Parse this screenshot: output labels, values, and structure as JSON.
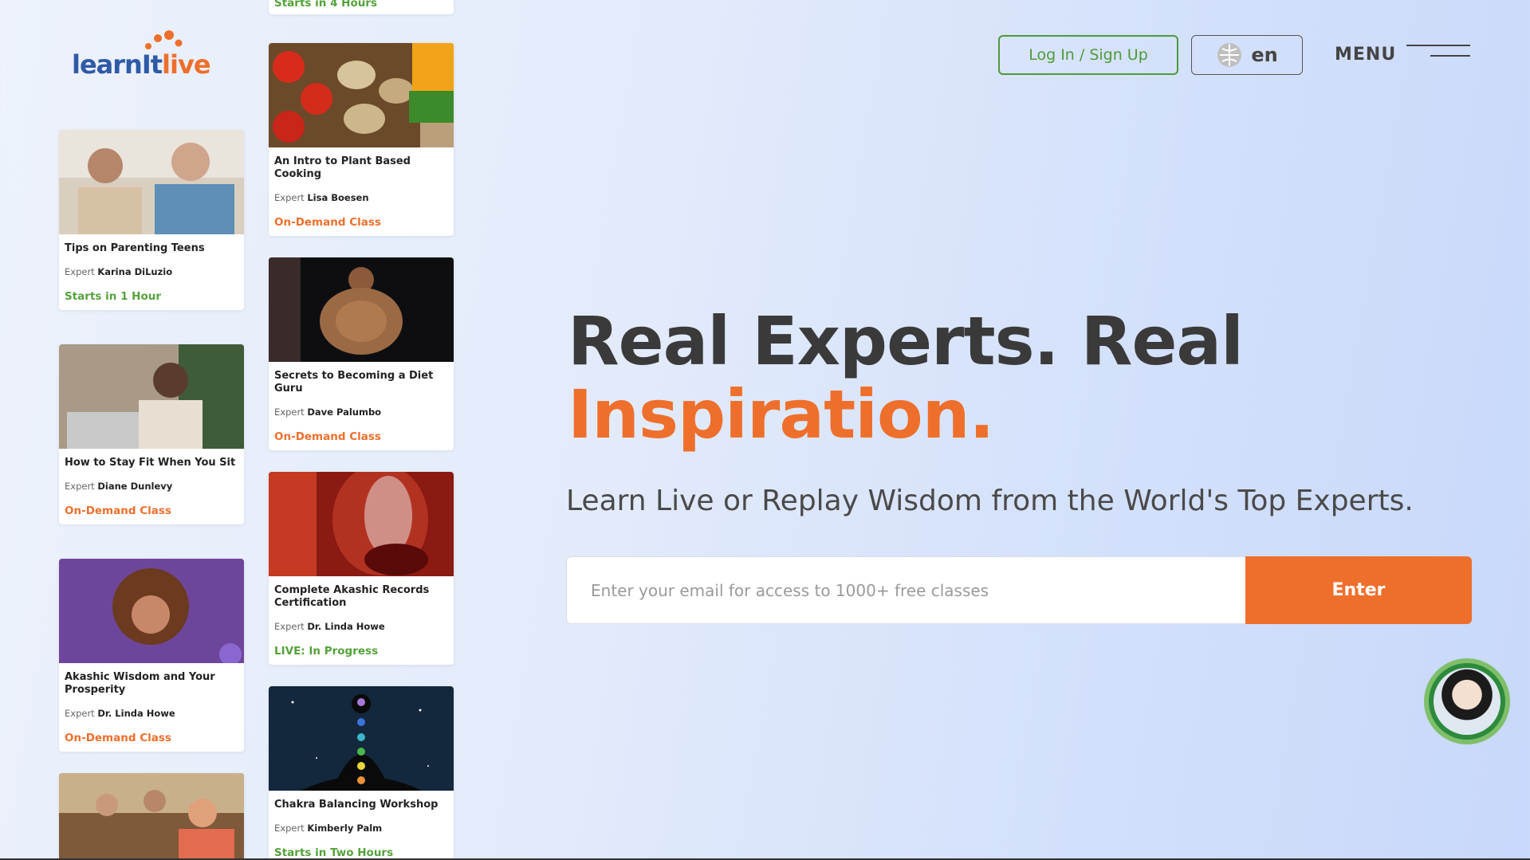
{
  "brand": {
    "logo_main": "learnIt",
    "logo_accent": "live",
    "colors": {
      "blue": "#2e5aa6",
      "orange": "#ee6f2c",
      "green": "#54a23a"
    }
  },
  "header": {
    "login_label": "Log In / Sign Up",
    "lang_label": "en",
    "lang_icon": "globe-icon",
    "menu_label": "MENU",
    "menu_icon": "hamburger-icon"
  },
  "hero": {
    "headline_part1": "Real Experts. Real",
    "headline_accent": "Inspiration.",
    "subhead": "Learn Live or Replay Wisdom from the World's Top Experts.",
    "email_placeholder": "Enter your email for access to 1000+ free classes",
    "enter_label": "Enter"
  },
  "classes_col1": [
    {
      "title": "Tips on Parenting Teens",
      "expert_prefix": "Expert",
      "expert": "Karina DiLuzio",
      "status": "Starts in 1 Hour",
      "status_color": "green"
    },
    {
      "title": "How to Stay Fit When You Sit",
      "expert_prefix": "Expert",
      "expert": "Diane Dunlevy",
      "status": "On-Demand Class",
      "status_color": "orange"
    },
    {
      "title": "Akashic Wisdom and Your Prosperity",
      "expert_prefix": "Expert",
      "expert": "Dr. Linda Howe",
      "status": "On-Demand Class",
      "status_color": "orange"
    },
    {
      "title": "",
      "expert_prefix": "",
      "expert": "",
      "status": "",
      "status_color": "orange"
    }
  ],
  "classes_col2": [
    {
      "title": "",
      "expert_prefix": "",
      "expert": "",
      "status": "Starts in 4 Hours",
      "status_color": "green"
    },
    {
      "title": "An Intro to Plant Based Cooking",
      "expert_prefix": "Expert",
      "expert": "Lisa Boesen",
      "status": "On-Demand Class",
      "status_color": "orange"
    },
    {
      "title": "Secrets to Becoming a Diet Guru",
      "expert_prefix": "Expert",
      "expert": "Dave Palumbo",
      "status": "On-Demand Class",
      "status_color": "orange"
    },
    {
      "title": "Complete Akashic Records Certification",
      "expert_prefix": "Expert",
      "expert": "Dr. Linda Howe",
      "status": "LIVE: In Progress",
      "status_color": "green"
    },
    {
      "title": "Chakra Balancing Workshop",
      "expert_prefix": "Expert",
      "expert": "Kimberly Palm",
      "status": "Starts in Two Hours",
      "status_color": "green"
    }
  ]
}
